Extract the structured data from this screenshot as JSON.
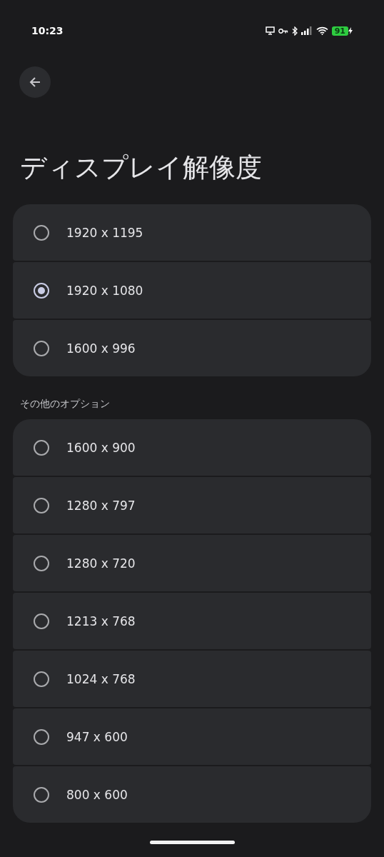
{
  "status_bar": {
    "time": "10:23",
    "battery": "91"
  },
  "title": "ディスプレイ解像度",
  "groups": [
    {
      "options": [
        {
          "label": "1920 x 1195",
          "selected": false
        },
        {
          "label": "1920 x 1080",
          "selected": true
        },
        {
          "label": "1600 x 996",
          "selected": false
        }
      ]
    },
    {
      "label": "その他のオプション",
      "options": [
        {
          "label": "1600 x 900",
          "selected": false
        },
        {
          "label": "1280 x 797",
          "selected": false
        },
        {
          "label": "1280 x 720",
          "selected": false
        },
        {
          "label": "1213 x 768",
          "selected": false
        },
        {
          "label": "1024 x 768",
          "selected": false
        },
        {
          "label": "947 x 600",
          "selected": false
        },
        {
          "label": "800 x 600",
          "selected": false
        }
      ]
    }
  ]
}
